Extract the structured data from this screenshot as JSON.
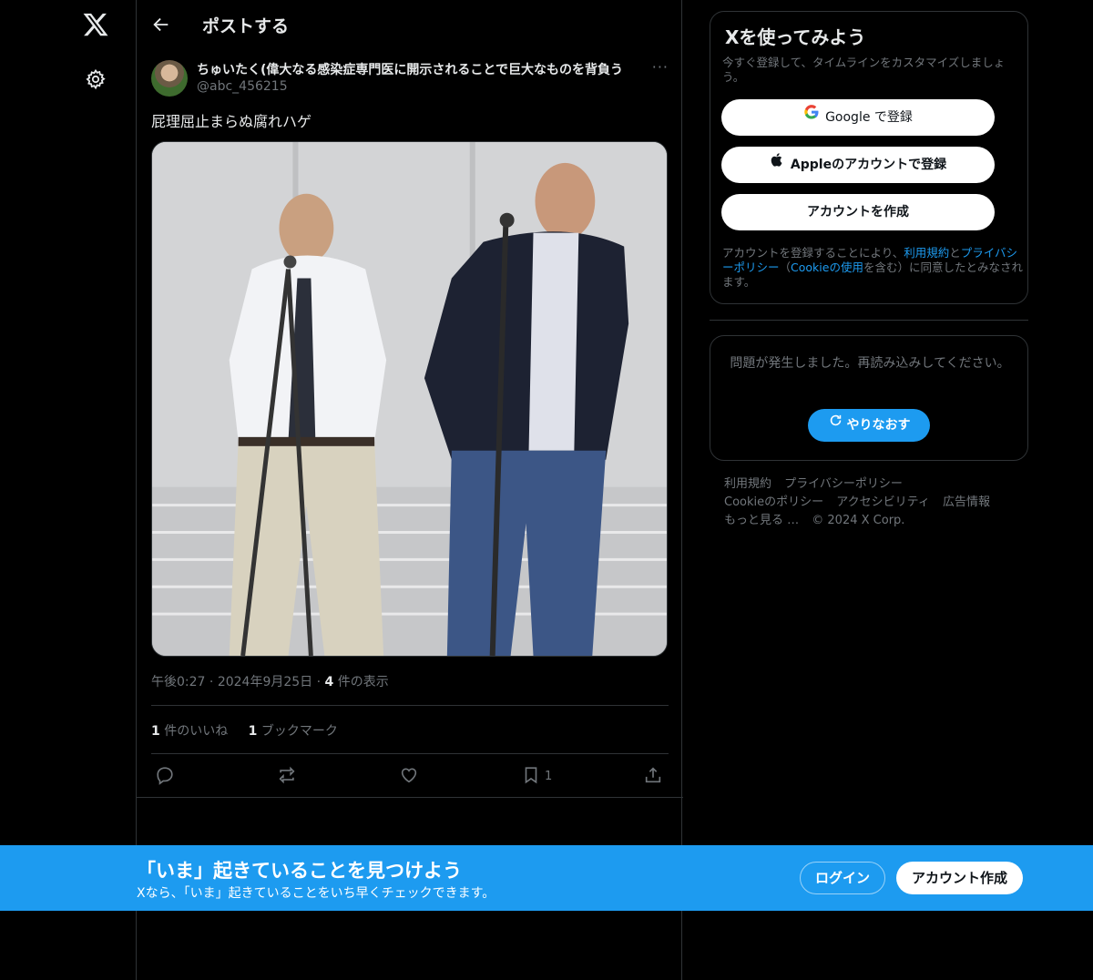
{
  "nav": {
    "logo_icon": "x-logo-icon",
    "settings_icon": "gear-icon"
  },
  "header": {
    "title": "ポストする",
    "back_icon": "arrow-left-icon"
  },
  "post": {
    "author_name": "ちゅいたく(偉大なる感染症専門医に開示されることで巨大なものを背負う",
    "author_handle": "@abc_456215",
    "text": "屁理屈止まらぬ腐れハゲ",
    "time": "午後0:27",
    "date": "2024年9月25日",
    "views_count": "4",
    "views_label": "件の表示",
    "likes_count": "1",
    "likes_label": "件のいいね",
    "bookmarks_count": "1",
    "bookmarks_label": "ブックマーク",
    "bookmark_action_count": "1",
    "more_label": "···"
  },
  "signup": {
    "title": "Xを使ってみよう",
    "subtitle": "今すぐ登録して、タイムラインをカスタマイズしましょう。",
    "google_brand": "Google",
    "google_suffix": " で登録",
    "apple_label": "Appleのアカウントで登録",
    "create_label": "アカウントを作成",
    "terms_prefix": "アカウントを登録することにより、",
    "terms_link": "利用規約",
    "terms_and": "と",
    "privacy_link": "プライバシーポリシー",
    "terms_paren_open": "（",
    "cookie_link": "Cookieの使用",
    "terms_paren_close": "を含む）に同意したとみなされます。"
  },
  "error": {
    "message": "問題が発生しました。再読み込みしてください。",
    "retry_label": "やりなおす"
  },
  "footer": {
    "links": [
      "利用規約",
      "プライバシーポリシー",
      "Cookieのポリシー",
      "アクセシビリティ",
      "広告情報",
      "もっと見る …"
    ],
    "copyright": "© 2024 X Corp."
  },
  "banner": {
    "headline": "「いま」起きていることを見つけよう",
    "description": "Xなら、「いま」起きていることをいち早くチェックできます。",
    "login_label": "ログイン",
    "signup_label": "アカウント作成"
  },
  "colors": {
    "accent": "#1d9bf0",
    "background": "#000000",
    "border": "#2f3336",
    "muted": "#71767b"
  }
}
